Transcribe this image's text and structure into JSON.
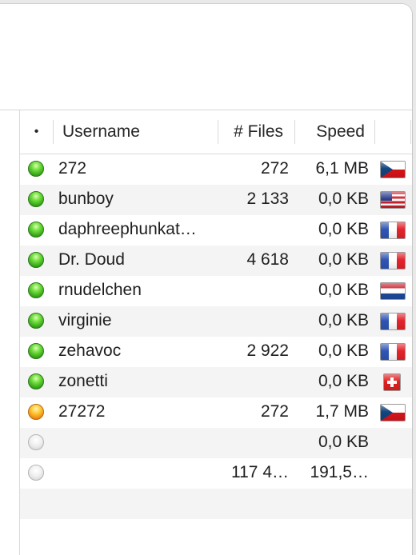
{
  "columns": {
    "status": "•",
    "username": "Username",
    "files": "# Files",
    "speed": "Speed"
  },
  "rows": [
    {
      "status": "green",
      "username": "272",
      "files": "272",
      "speed": "6,1 MB",
      "flag": "cz"
    },
    {
      "status": "green",
      "username": "bunboy",
      "files": "2 133",
      "speed": "0,0 KB",
      "flag": "us"
    },
    {
      "status": "green",
      "username": "daphreephunkat…",
      "files": "",
      "speed": "0,0 KB",
      "flag": "fr"
    },
    {
      "status": "green",
      "username": "Dr. Doud",
      "files": "4 618",
      "speed": "0,0 KB",
      "flag": "fr"
    },
    {
      "status": "green",
      "username": "rnudelchen",
      "files": "",
      "speed": "0,0 KB",
      "flag": "nl"
    },
    {
      "status": "green",
      "username": "virginie",
      "files": "",
      "speed": "0,0 KB",
      "flag": "fr"
    },
    {
      "status": "green",
      "username": "zehavoc",
      "files": "2 922",
      "speed": "0,0 KB",
      "flag": "fr"
    },
    {
      "status": "green",
      "username": "zonetti",
      "files": "",
      "speed": "0,0 KB",
      "flag": "ch"
    },
    {
      "status": "orange",
      "username": "27272",
      "files": "272",
      "speed": "1,7 MB",
      "flag": "cz"
    },
    {
      "status": "gray",
      "username": "",
      "files": "",
      "speed": "0,0 KB",
      "flag": ""
    },
    {
      "status": "gray",
      "username": "",
      "files": "117 4…",
      "speed": "191,5…",
      "flag": ""
    }
  ],
  "colors": {
    "status_green": "#2c9a12",
    "status_orange": "#f08a10",
    "status_gray": "#cfcfcf",
    "row_alt": "#f4f4f4"
  }
}
